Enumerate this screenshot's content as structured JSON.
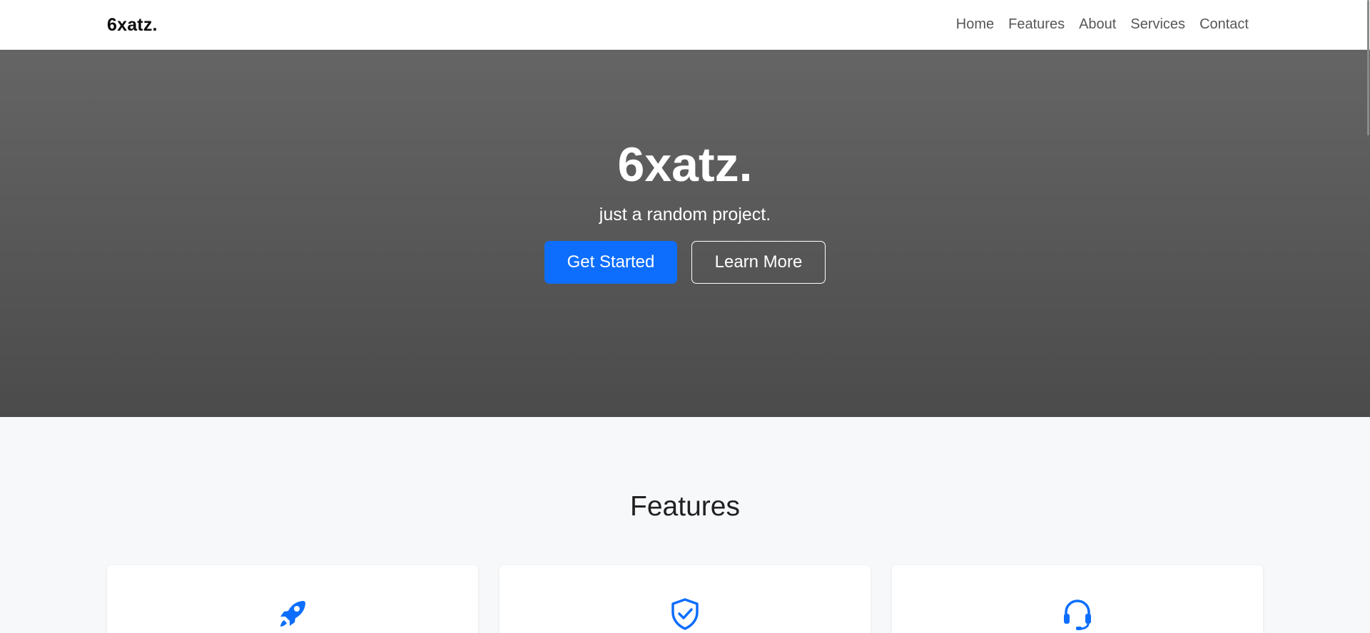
{
  "navbar": {
    "brand": "6xatz.",
    "links": [
      "Home",
      "Features",
      "About",
      "Services",
      "Contact"
    ]
  },
  "hero": {
    "title": "6xatz.",
    "subtitle": "just a random project.",
    "primary_button": "Get Started",
    "secondary_button": "Learn More"
  },
  "features": {
    "title": "Features",
    "cards": [
      {
        "icon": "rocket-icon"
      },
      {
        "icon": "shield-check-icon"
      },
      {
        "icon": "headset-icon"
      }
    ]
  },
  "colors": {
    "accent": "#0d6efd",
    "hero_top": "#656565",
    "hero_bottom": "#4b4b4b",
    "icon": "#0d6efd"
  }
}
